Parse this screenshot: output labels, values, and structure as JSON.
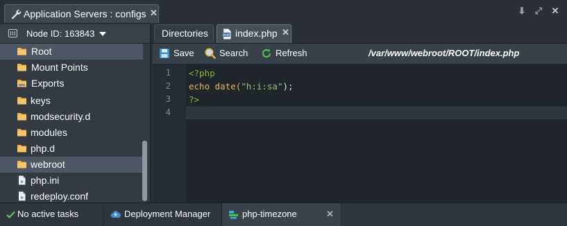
{
  "window": {
    "tab_title": "Application Servers : configs",
    "close_glyph": "✕",
    "controls": [
      {
        "name": "download-icon",
        "glyph": "⬇"
      },
      {
        "name": "expand-icon",
        "glyph": "⤢"
      },
      {
        "name": "close-window-icon",
        "glyph": "✕"
      }
    ]
  },
  "sidebar": {
    "node_label": "Node ID: 163843",
    "items": [
      {
        "label": "Root",
        "icon": "folder-icon",
        "selected": true
      },
      {
        "label": "Mount Points",
        "icon": "folder-icon",
        "selected": false
      },
      {
        "label": "Exports",
        "icon": "folder-export-icon",
        "selected": false
      },
      {
        "label": "keys",
        "icon": "folder-icon",
        "selected": false
      },
      {
        "label": "modsecurity.d",
        "icon": "folder-icon",
        "selected": false
      },
      {
        "label": "modules",
        "icon": "folder-icon",
        "selected": false
      },
      {
        "label": "php.d",
        "icon": "folder-icon",
        "selected": false
      },
      {
        "label": "webroot",
        "icon": "folder-icon",
        "selected": true
      },
      {
        "label": "php.ini",
        "icon": "file-icon",
        "selected": false
      },
      {
        "label": "redeploy.conf",
        "icon": "file-icon",
        "selected": false
      }
    ]
  },
  "editor_tabs": {
    "directories": "Directories",
    "file": "index.php",
    "close_glyph": "✕"
  },
  "toolbar": {
    "save": "Save",
    "search": "Search",
    "refresh": "Refresh",
    "path": "/var/www/webroot/ROOT/index.php"
  },
  "editor": {
    "line_numbers": [
      "1",
      "2",
      "3",
      "4"
    ],
    "code": {
      "l1": "<?php",
      "l2_fn": "echo date(",
      "l2_str": "\"h:i:sa\"",
      "l2_end": ");",
      "l3": "?>"
    },
    "active_line": 4
  },
  "statusbar": {
    "tasks": "No active tasks",
    "deploy": "Deployment Manager",
    "tz": "php-timezone",
    "close_glyph": "✕"
  },
  "colors": {
    "accent_blue": "#3d8fd8",
    "folder": "#f2b24c",
    "success": "#5cc45c",
    "refresh": "#4cc04c",
    "tz_icon": "#36b0d8"
  }
}
